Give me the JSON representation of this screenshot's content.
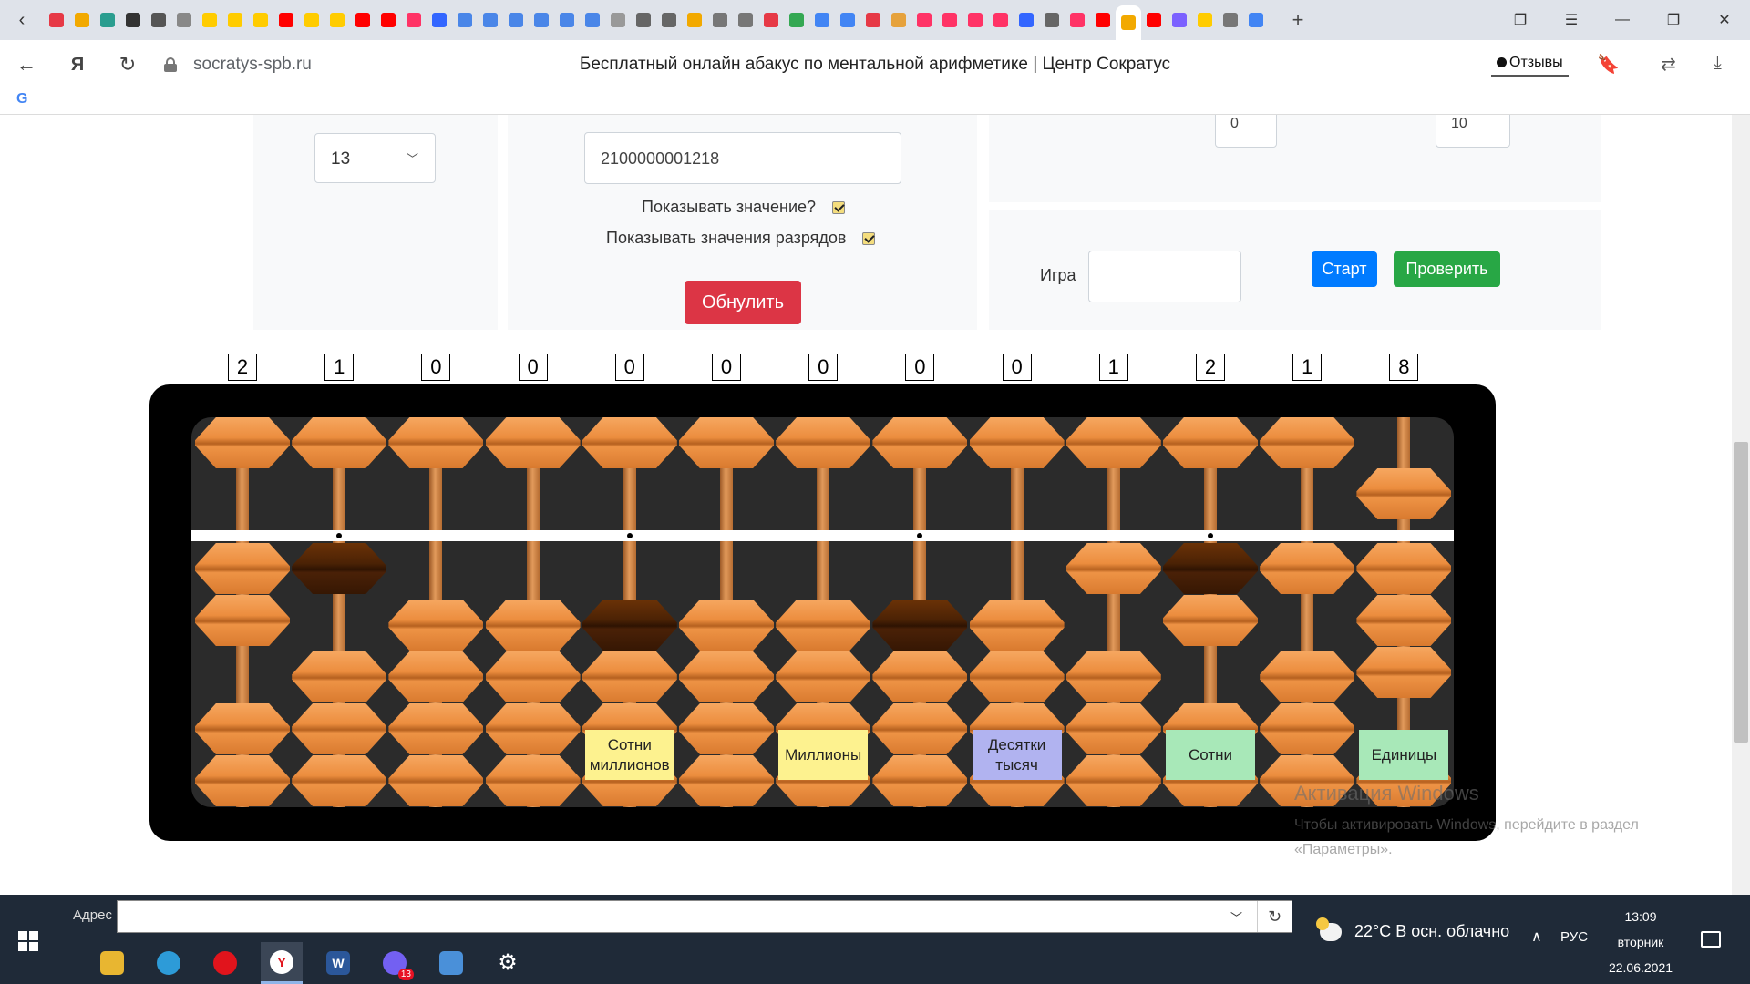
{
  "browser": {
    "page_title": "Бесплатный онлайн абакус по ментальной арифметике | Центр Сократус",
    "domain": "socratys-spb.ru",
    "reviews_label": "Отзывы",
    "tab_favicon_colors": [
      "#e63946",
      "#f2a900",
      "#2a9d8f",
      "#333333",
      "#555555",
      "#888888",
      "#ffcc00",
      "#ffcc00",
      "#ffcc00",
      "#ff0000",
      "#ffcc00",
      "#ffcc00",
      "#ff0000",
      "#ff0000",
      "#ff3366",
      "#3366ff",
      "#4a86e8",
      "#4a86e8",
      "#4a86e8",
      "#4a86e8",
      "#4a86e8",
      "#4a86e8",
      "#999999",
      "#666666",
      "#666666",
      "#f2a900",
      "#777777",
      "#777777",
      "#e63946",
      "#34a853",
      "#4285f4",
      "#4285f4",
      "#e63946",
      "#e6a23c",
      "#ff3366",
      "#ff3366",
      "#ff3366",
      "#ff3366",
      "#3366ff",
      "#666666",
      "#ff3366",
      "#ff0000",
      "#f2a900",
      "#ff0000",
      "#7b61ff",
      "#ffcc00",
      "#777777",
      "#4285f4"
    ]
  },
  "settings": {
    "rods_value": "13",
    "value": "2100000001218",
    "show_value_label": "Показывать значение?",
    "show_place_values_label": "Показывать значения разрядов",
    "reset_label": "Обнулить",
    "range_from_value": "0",
    "range_to_value": "10",
    "game_label": "Игра",
    "start_label": "Старт",
    "check_label": "Проверить"
  },
  "abacus": {
    "digits": [
      "2",
      "1",
      "0",
      "0",
      "0",
      "0",
      "0",
      "0",
      "0",
      "1",
      "2",
      "1",
      "8"
    ],
    "upper_active": [
      false,
      false,
      false,
      false,
      false,
      false,
      false,
      false,
      false,
      false,
      false,
      false,
      true
    ],
    "lower_count": [
      2,
      1,
      0,
      0,
      0,
      0,
      0,
      0,
      0,
      1,
      2,
      1,
      3
    ],
    "dark_lower_index": [
      null,
      0,
      null,
      null,
      0,
      null,
      null,
      0,
      null,
      null,
      0,
      null,
      null
    ],
    "beam_dot_columns": [
      2,
      5,
      8,
      11
    ]
  },
  "place_labels": [
    {
      "text": "Сотни миллионов",
      "color": "#fdf28f"
    },
    {
      "text": "Миллионы",
      "color": "#fdf28f"
    },
    {
      "text": "Десятки тысяч",
      "color": "#b1b3f0"
    },
    {
      "text": "Сотни",
      "color": "#a8e8b8"
    },
    {
      "text": "Единицы",
      "color": "#a8e8b8"
    }
  ],
  "watermark": {
    "title": "Активация Windows",
    "text": "Чтобы активировать Windows, перейдите в раздел «Параметры»."
  },
  "taskbar": {
    "address_label": "Адрес",
    "weather": "22°C  В осн. облачно",
    "language": "РУС",
    "time": "13:09",
    "weekday": "вторник",
    "date": "22.06.2021",
    "viber_badge": "13"
  }
}
